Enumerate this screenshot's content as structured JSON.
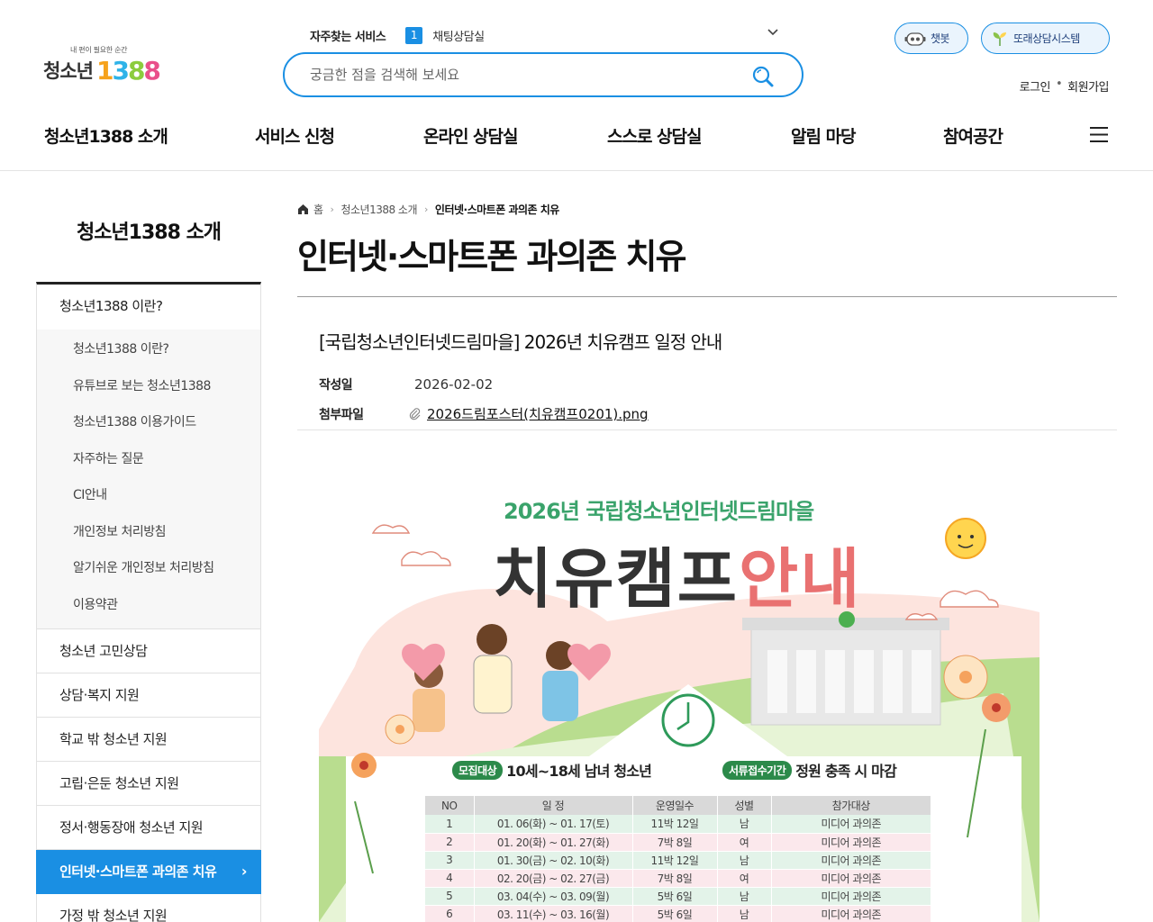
{
  "header": {
    "logo_tagline": "내 편이 필요한 순간",
    "logo_text": "청소년",
    "logo_number": [
      "1",
      "3",
      "8",
      "8"
    ],
    "quick_label": "자주찾는 서비스",
    "quick_index": "1",
    "quick_item": "채팅상담실",
    "search_placeholder": "궁금한 점을 검색해 보세요",
    "chatbot_label": "챗봇",
    "peer_label": "또래상담시스템",
    "login_label": "로그인",
    "auth_dot": "•",
    "signup_label": "회원가입"
  },
  "gnb": [
    {
      "label": "청소년1388 소개"
    },
    {
      "label": "서비스 신청"
    },
    {
      "label": "온라인 상담실"
    },
    {
      "label": "스스로 상담실"
    },
    {
      "label": "알림 마당"
    },
    {
      "label": "참여공간"
    }
  ],
  "sidebar": {
    "title": "청소년1388 소개",
    "group_head": "청소년1388 이란?",
    "sub_items": [
      {
        "label": "청소년1388 이란?"
      },
      {
        "label": "유튜브로 보는 청소년1388"
      },
      {
        "label": "청소년1388 이용가이드"
      },
      {
        "label": "자주하는 질문"
      },
      {
        "label": "CI안내"
      },
      {
        "label": "개인정보 처리방침"
      },
      {
        "label": "알기쉬운 개인정보 처리방침"
      },
      {
        "label": "이용약관"
      }
    ],
    "items": [
      {
        "label": "청소년 고민상담"
      },
      {
        "label": "상담·복지 지원"
      },
      {
        "label": "학교 밖 청소년 지원"
      },
      {
        "label": "고립·은둔 청소년 지원"
      },
      {
        "label": "정서·행동장애 청소년 지원"
      },
      {
        "label": "인터넷·스마트폰 과의존 치유"
      },
      {
        "label": "가정 밖 청소년 지원"
      }
    ],
    "active_arrow": "›"
  },
  "breadcrumb": {
    "home": "홈",
    "level1": "청소년1388 소개",
    "current": "인터넷·스마트폰 과의존 치유",
    "sep": "›"
  },
  "page": {
    "title": "인터넷·스마트폰 과의존 치유"
  },
  "post": {
    "title": "[국립청소년인터넷드림마을] 2026년 치유캠프 일정 안내",
    "date_label": "작성일",
    "date": "2026-02-02",
    "attach_label": "첨부파일",
    "attach_name": "2026드림포스터(치유캠프0201).png"
  },
  "poster": {
    "subtitle": "2026년 국립청소년인터넷드림마을",
    "title_dark": "치유캠프",
    "title_pink": "안내",
    "recruit_badge": "모집대상",
    "recruit_text": "10세~18세 남녀 청소년",
    "period_badge": "서류접수기간",
    "period_text": "정원 충족 시 마감",
    "table_headers": [
      "NO",
      "일 정",
      "운영일수",
      "성별",
      "참가대상"
    ],
    "table_rows": [
      [
        "1",
        "01. 06(화) ~ 01. 17(토)",
        "11박 12일",
        "남",
        "미디어 과의존"
      ],
      [
        "2",
        "01. 20(화) ~ 01. 27(화)",
        "7박 8일",
        "여",
        "미디어 과의존"
      ],
      [
        "3",
        "01. 30(금) ~ 02. 10(화)",
        "11박 12일",
        "남",
        "미디어 과의존"
      ],
      [
        "4",
        "02. 20(금) ~ 02. 27(금)",
        "7박 8일",
        "여",
        "미디어 과의존"
      ],
      [
        "5",
        "03. 04(수) ~ 03. 09(월)",
        "5박 6일",
        "남",
        "미디어 과의존"
      ],
      [
        "6",
        "03. 11(수) ~ 03. 16(월)",
        "5박 6일",
        "남",
        "미디어 과의존"
      ]
    ]
  },
  "colors": {
    "primary": "#1a8fe3",
    "poster_green": "#3aa36b",
    "poster_pink": "#e97171"
  }
}
